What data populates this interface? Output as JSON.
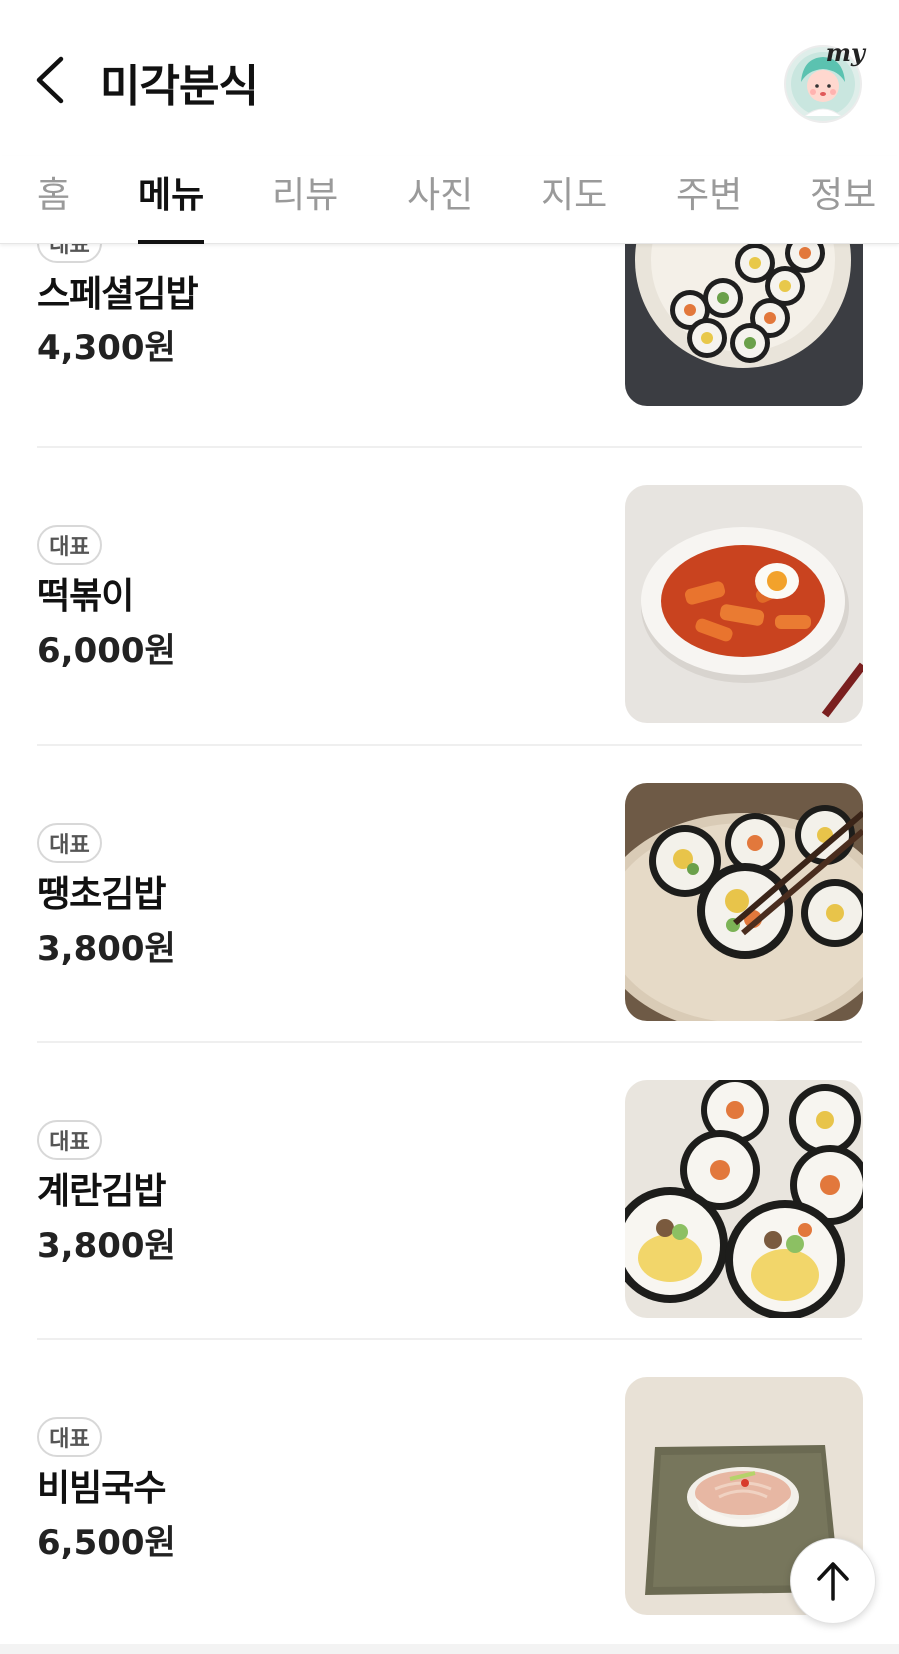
{
  "header": {
    "title": "미각분식",
    "back_icon": "chevron-left-icon",
    "my_label": "my"
  },
  "tabs": [
    {
      "label": "홈",
      "active": false
    },
    {
      "label": "메뉴",
      "active": true
    },
    {
      "label": "리뷰",
      "active": false
    },
    {
      "label": "사진",
      "active": false
    },
    {
      "label": "지도",
      "active": false
    },
    {
      "label": "주변",
      "active": false
    },
    {
      "label": "정보",
      "active": false
    }
  ],
  "menu": {
    "items": [
      {
        "badge": "대표",
        "name": "스페셜김밥",
        "price": "4,300원",
        "photo": "kimbap-plate-photo"
      },
      {
        "badge": "대표",
        "name": "떡볶이",
        "price": "6,000원",
        "photo": "tteokbokki-bowl-photo"
      },
      {
        "badge": "대표",
        "name": "땡초김밥",
        "price": "3,800원",
        "photo": "kimbap-chopsticks-photo"
      },
      {
        "badge": "대표",
        "name": "계란김밥",
        "price": "3,800원",
        "photo": "egg-kimbap-photo"
      },
      {
        "badge": "대표",
        "name": "비빔국수",
        "price": "6,500원",
        "photo": "bibim-noodles-photo"
      }
    ]
  },
  "scroll_top_icon": "arrow-up-icon",
  "colors": {
    "text": "#111111",
    "muted_tab": "#9a9a9a",
    "badge_border": "#d8d8d8",
    "divider": "#efefef"
  }
}
